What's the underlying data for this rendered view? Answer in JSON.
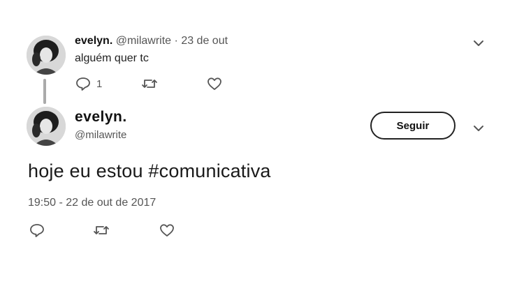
{
  "reply_tweet": {
    "name": "evelyn.",
    "handle": "@milawrite",
    "separator": "·",
    "date": "23 de out",
    "text": "alguém quer tc",
    "reply_count": "1",
    "icons": [
      "reply-icon",
      "retweet-icon",
      "like-icon",
      "chevron-down-icon"
    ]
  },
  "main_tweet": {
    "name": "evelyn.",
    "handle": "@milawrite",
    "follow_label": "Seguir",
    "text": "hoje eu estou #comunicativa",
    "timestamp": "19:50 - 22 de out de 2017",
    "icons": [
      "reply-icon",
      "retweet-icon",
      "like-icon",
      "chevron-down-icon"
    ]
  }
}
